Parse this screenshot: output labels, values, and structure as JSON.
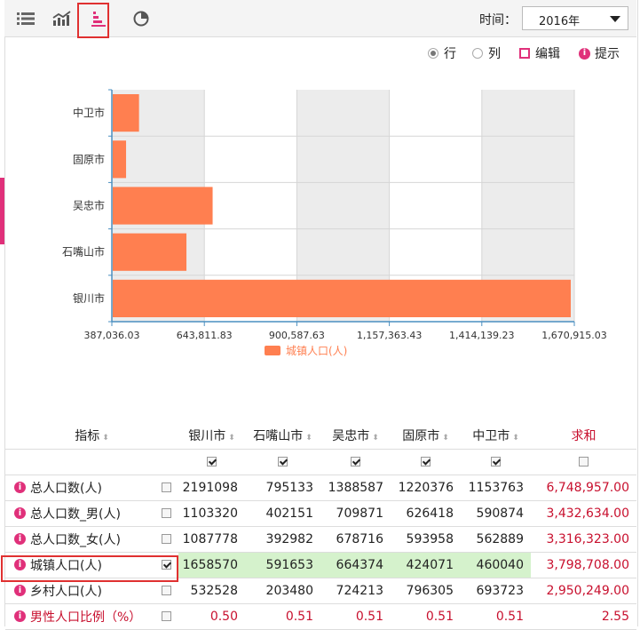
{
  "toolbar": {
    "icons": [
      "list-icon",
      "line-chart-icon",
      "bar-chart-icon",
      "pie-chart-icon"
    ],
    "time_label": "时间：",
    "time_value": "2016年"
  },
  "options": {
    "row_label": "行",
    "col_label": "列",
    "edit_label": "编辑",
    "hint_label": "提示"
  },
  "chart_data": {
    "type": "bar",
    "orientation": "horizontal",
    "categories": [
      "中卫市",
      "固原市",
      "吴忠市",
      "石嘴山市",
      "银川市"
    ],
    "series": [
      {
        "name": "城镇人口(人)",
        "values": [
          460040,
          424071,
          664374,
          591653,
          1658570
        ]
      }
    ],
    "x_ticks": [
      "387,036.03",
      "643,811.83",
      "900,587.63",
      "1,157,363.43",
      "1,414,139.23",
      "1,670,915.03"
    ],
    "xlim": [
      387036.03,
      1670915.03
    ],
    "legend": "bottom",
    "grid": true,
    "bar_color": "#ff7f50"
  },
  "table": {
    "headers": [
      "指标",
      "银川市",
      "石嘴山市",
      "吴忠市",
      "固原市",
      "中卫市",
      "求和"
    ],
    "rows": [
      {
        "name": "总人口数(人)",
        "checked": false,
        "values": [
          "2191098",
          "795133",
          "1388587",
          "1220376",
          "1153763"
        ],
        "sum": "6,748,957.00"
      },
      {
        "name": "总人口数_男(人)",
        "checked": false,
        "values": [
          "1103320",
          "402151",
          "709871",
          "626418",
          "590874"
        ],
        "sum": "3,432,634.00"
      },
      {
        "name": "总人口数_女(人)",
        "checked": false,
        "values": [
          "1087778",
          "392982",
          "678716",
          "593958",
          "562889"
        ],
        "sum": "3,316,323.00"
      },
      {
        "name": "城镇人口(人)",
        "checked": true,
        "values": [
          "1658570",
          "591653",
          "664374",
          "424071",
          "460040"
        ],
        "sum": "3,798,708.00"
      },
      {
        "name": "乡村人口(人)",
        "checked": false,
        "values": [
          "532528",
          "203480",
          "724213",
          "796305",
          "693723"
        ],
        "sum": "2,950,249.00"
      },
      {
        "name": "男性人口比例（%）",
        "checked": false,
        "values": [
          "0.50",
          "0.51",
          "0.51",
          "0.51",
          "0.51"
        ],
        "sum": "2.55"
      }
    ]
  },
  "colors": {
    "accent": "#e0307a",
    "bar": "#ff7f50",
    "sum_text": "#c8102e",
    "highlight": "#d5f2cc"
  }
}
